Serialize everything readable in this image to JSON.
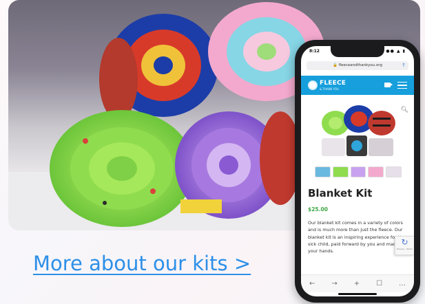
{
  "link": {
    "label": "More about our kits >"
  },
  "phone": {
    "status_time": "8:12",
    "status_icons": "●● ▲ ▮",
    "url": "🔒 fleeceandthankyou.org",
    "brand": "FLEECE",
    "brand_sub": "& THANK YOU",
    "product_title": "Blanket Kit",
    "price": "$25.00",
    "description": "Our blanket kit comes in a variety of colors and is much more than just the fleece. Our blanket kit is an inspiring experience for the sick child, paid forward by you and made by your hands.",
    "recaptcha_text": "Privacy - Terms",
    "nav": [
      "←",
      "→",
      "+",
      "☐",
      "…"
    ]
  },
  "colors": {
    "link": "#2c8fe8",
    "brand_bar": "#169fdc",
    "price": "#3ea544"
  },
  "icons": {
    "share": "share-icon",
    "camera": "video-camera-icon",
    "menu": "hamburger-menu-icon",
    "zoom": "magnifier-icon"
  }
}
